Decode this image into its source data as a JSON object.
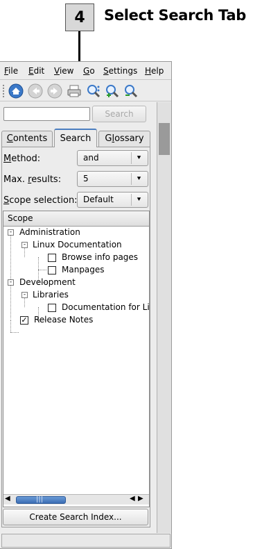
{
  "callout": {
    "step": "4",
    "text": "Select Search Tab"
  },
  "menubar": [
    {
      "label": "File",
      "u": "F",
      "rest": "ile"
    },
    {
      "label": "Edit",
      "u": "E",
      "rest": "dit"
    },
    {
      "label": "View",
      "u": "V",
      "rest": "iew"
    },
    {
      "label": "Go",
      "u": "G",
      "rest": "o"
    },
    {
      "label": "Settings",
      "u": "S",
      "rest": "ettings"
    },
    {
      "label": "Help",
      "u": "H",
      "rest": "elp"
    }
  ],
  "toolbar": {
    "icons": [
      "home-icon",
      "back-icon",
      "forward-icon",
      "print-icon",
      "find-icon",
      "zoom-in-icon",
      "zoom-out-icon"
    ]
  },
  "search": {
    "input_value": "",
    "button_label": "Search"
  },
  "tabs": [
    {
      "label": "Contents",
      "u": "C",
      "rest": "ontents"
    },
    {
      "label": "Search"
    },
    {
      "label": "Glossary",
      "pre": "G",
      "u": "l",
      "rest": "ossary"
    }
  ],
  "fields": {
    "method": {
      "label_u": "M",
      "label_rest": "ethod:",
      "value": "and"
    },
    "max_results": {
      "label_pre": "Max. ",
      "label_u": "r",
      "label_rest": "esults:",
      "value": "5"
    },
    "scope_selection": {
      "label_u": "S",
      "label_rest": "cope selection:",
      "value": "Default"
    }
  },
  "tree": {
    "header": "Scope",
    "nodes": {
      "administration": "Administration",
      "linux_documentation": "Linux Documentation",
      "browse_info_pages": "Browse info pages",
      "manpages": "Manpages",
      "development": "Development",
      "libraries": "Libraries",
      "documentation_for_lin": "Documentation for Lin",
      "release_notes": "Release Notes"
    },
    "checked": {
      "browse_info_pages": false,
      "manpages": false,
      "documentation_for_lin": false,
      "release_notes": true
    }
  },
  "create_index_label": "Create Search Index...",
  "colors": {
    "accent": "#4a7ec0",
    "scroll_thumb": "#3c6eb4"
  }
}
